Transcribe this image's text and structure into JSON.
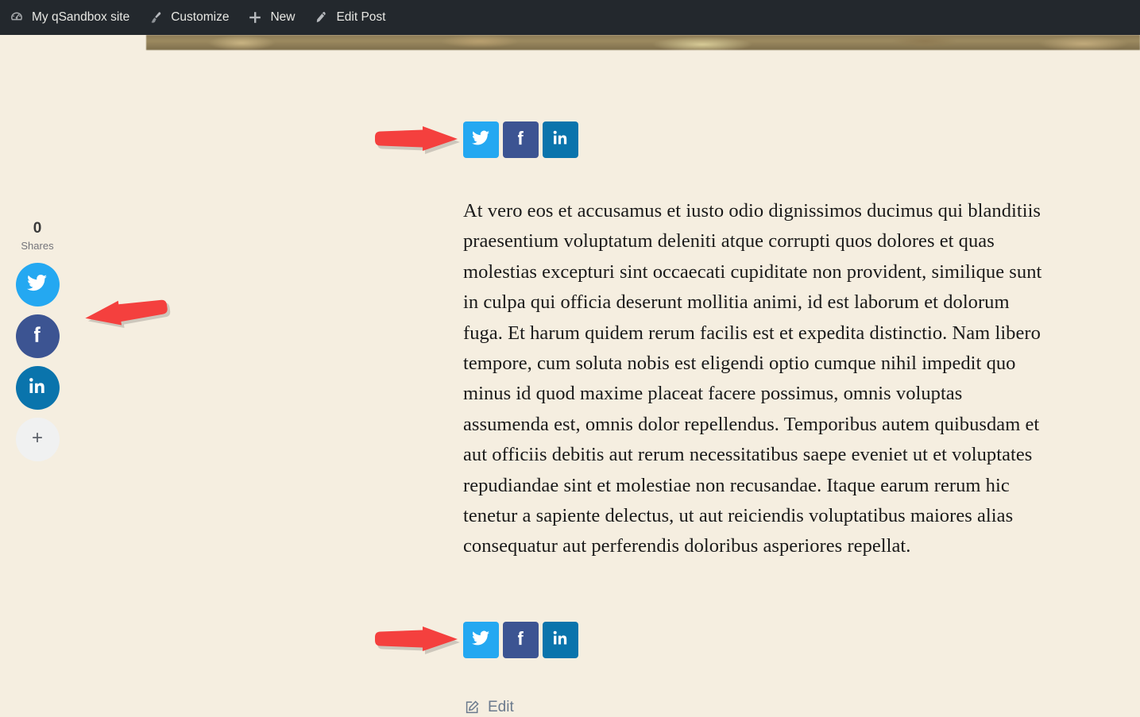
{
  "page": {
    "background_color": "#F5EEE0",
    "text_color": "#1A1A1A"
  },
  "admin_bar": {
    "background_color": "#23282D",
    "items": [
      {
        "icon": "wordpress-dashboard-icon",
        "label": "My qSandbox site"
      },
      {
        "icon": "paintbrush-icon",
        "label": "Customize"
      },
      {
        "icon": "plus-icon",
        "label": "New"
      },
      {
        "icon": "pencil-icon",
        "label": "Edit Post"
      }
    ]
  },
  "share_rail": {
    "count": "0",
    "count_label": "Shares",
    "buttons": [
      {
        "network": "twitter",
        "icon": "twitter-icon",
        "color": "#24A8F1"
      },
      {
        "network": "facebook",
        "icon": "facebook-icon",
        "color": "#3C5492"
      },
      {
        "network": "linkedin",
        "icon": "linkedin-icon",
        "color": "#0A74AC"
      },
      {
        "network": "more",
        "icon": "plus-icon",
        "color": "#F0F1F1",
        "glyph": "+"
      }
    ]
  },
  "share_buttons_top": [
    {
      "network": "twitter",
      "icon": "twitter-icon",
      "color": "#24A8F1"
    },
    {
      "network": "facebook",
      "icon": "facebook-icon",
      "color": "#3C5492"
    },
    {
      "network": "linkedin",
      "icon": "linkedin-icon",
      "color": "#0A74AC"
    }
  ],
  "share_buttons_bottom": [
    {
      "network": "twitter",
      "icon": "twitter-icon",
      "color": "#24A8F1"
    },
    {
      "network": "facebook",
      "icon": "facebook-icon",
      "color": "#3C5492"
    },
    {
      "network": "linkedin",
      "icon": "linkedin-icon",
      "color": "#0A74AC"
    }
  ],
  "post": {
    "body": "At vero eos et accusamus et iusto odio dignissimos ducimus qui blanditiis praesentium voluptatum deleniti atque corrupti quos dolores et quas molestias excepturi sint occaecati cupiditate non provident, similique sunt in culpa qui officia deserunt mollitia animi, id est laborum et dolorum fuga. Et harum quidem rerum facilis est et expedita distinctio. Nam libero tempore, cum soluta nobis est eligendi optio cumque nihil impedit quo minus id quod maxime placeat facere possimus, omnis voluptas assumenda est, omnis dolor repellendus. Temporibus autem quibusdam et aut officiis debitis aut rerum necessitatibus saepe eveniet ut et voluptates repudiandae sint et molestiae non recusandae. Itaque earum rerum hic tenetur a sapiente delectus, ut aut reiciendis voluptatibus maiores alias consequatur aut perferendis doloribus asperiores repellat."
  },
  "edit_link": {
    "icon": "edit-square-icon",
    "label": "Edit",
    "color": "#6B7A8D"
  },
  "annotations": {
    "arrow_color": "#F4403E",
    "arrows": [
      {
        "name": "arrow-to-top-share-buttons",
        "direction": "right"
      },
      {
        "name": "arrow-to-bottom-share-buttons",
        "direction": "right"
      },
      {
        "name": "arrow-to-floating-share-rail",
        "direction": "left"
      }
    ]
  }
}
